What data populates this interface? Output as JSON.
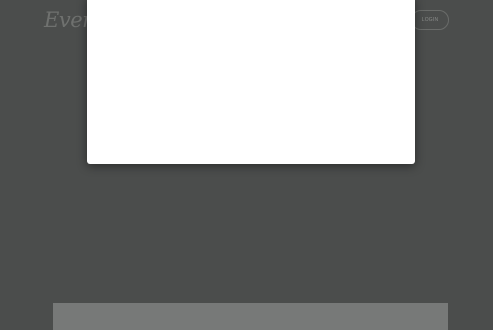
{
  "header": {
    "logo_text": "Even",
    "login_label": "LOGIN"
  },
  "colors": {
    "overlay_background": "#4b4d4c",
    "modal_background": "#ffffff",
    "panel_background": "#777978"
  }
}
